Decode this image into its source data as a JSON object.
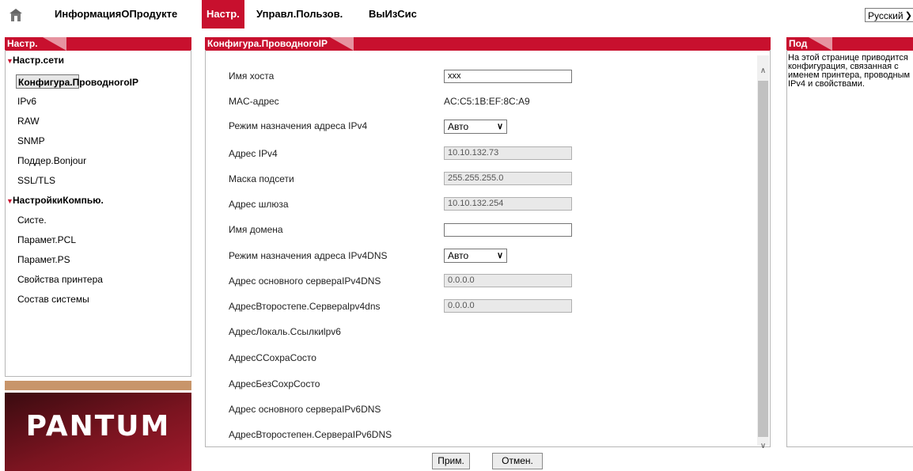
{
  "nav": {
    "items": [
      "ИнформацияОПродукте",
      "Настр.",
      "Управл.Пользов.",
      "ВыИзСис"
    ],
    "active": "Настр.",
    "language": "Русский"
  },
  "left": {
    "header": "Настр.",
    "section1": "Настр.сети",
    "section1_items": [
      "Конфигура.ПроводногоIP",
      "IPv6",
      "RAW",
      "SNMP",
      "Поддер.Bonjour",
      "SSL/TLS"
    ],
    "section2": "НастройкиКомпью.",
    "section2_items": [
      "Систе.",
      "Парамет.PCL",
      "Парамет.PS",
      "Свойства принтера",
      "Состав системы"
    ],
    "logo": "PANTUM"
  },
  "main": {
    "header": "Конфигура.ПроводногоIP",
    "fields": {
      "hostname_label": "Имя хоста",
      "hostname_value": "xxx",
      "mac_label": "MAC-адрес",
      "mac_value": "AC:C5:1B:EF:8C:A9",
      "ipv4_mode_label": "Режим назначения адреса IPv4",
      "ipv4_mode_value": "Авто",
      "ipv4_label": "Адрес IPv4",
      "ipv4_value": "10.10.132.73",
      "mask_label": "Маска подсети",
      "mask_value": "255.255.255.0",
      "gateway_label": "Адрес шлюза",
      "gateway_value": "10.10.132.254",
      "domain_label": "Имя домена",
      "domain_value": "",
      "dns_mode_label": "Режим назначения адреса IPv4DNS",
      "dns_mode_value": "Авто",
      "dns_primary_label": "Адрес основного сервераIPv4DNS",
      "dns_primary_value": "0.0.0.0",
      "dns_secondary_label": "АдресВторостепе.Сервераlpv4dns",
      "dns_secondary_value": "0.0.0.0",
      "link_local_label": "АдресЛокаль.Ссылкиlpv6",
      "stateful_label": "АдресССохраСосто",
      "stateless_label": "АдресБезСохрСосто",
      "v6dns_primary_label": "Адрес основного сервераIPv6DNS",
      "v6dns_secondary_label": "АдресВторостепен.СервераIPv6DNS"
    },
    "apply": "Прим.",
    "cancel": "Отмен."
  },
  "help": {
    "header": "Под",
    "text": "На этой странице приводится конфигурация, связанная с именем принтера, проводным IPv4 и свойствами."
  },
  "colors": {
    "accent": "#c8102e",
    "tan": "#c8956a"
  }
}
